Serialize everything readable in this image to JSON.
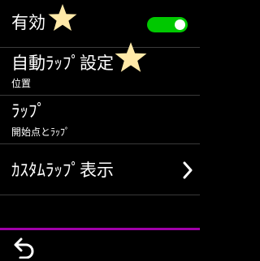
{
  "items": [
    {
      "title": "有効",
      "toggle_on": true,
      "icon": "toggle-switch"
    },
    {
      "title": "自動ﾗｯﾌﾟ設定",
      "subtitle": "位置"
    },
    {
      "title": "ﾗｯﾌﾟ",
      "subtitle": "開始点とﾗｯﾌﾟ"
    },
    {
      "title": "ｶｽﾀﾑﾗｯﾌﾟ表示",
      "icon": "chevron-right-icon"
    }
  ],
  "footer": {
    "icon": "back-arrow-icon",
    "accent_color": "#a000a8"
  },
  "colors": {
    "toggle_on": "#00c800",
    "star": "#ffe9a8",
    "background": "#000000"
  },
  "decorations": {
    "icon": "star-icon"
  }
}
